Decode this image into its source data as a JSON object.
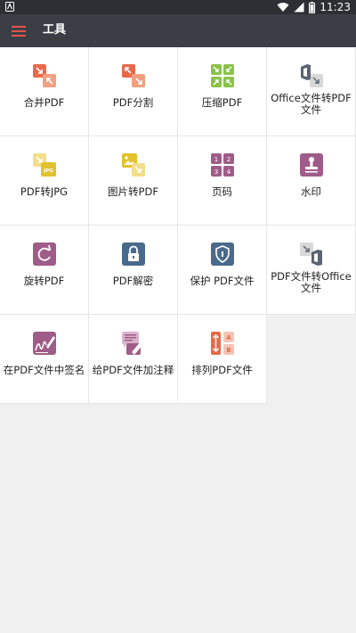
{
  "status_bar": {
    "time": "11:23",
    "icons": [
      "notification-icon",
      "wifi-icon",
      "signal-icon",
      "battery-icon"
    ]
  },
  "app_bar": {
    "title": "工具",
    "menu_icon": "hamburger-menu-icon",
    "menu_color": "#e5534b"
  },
  "tools": [
    {
      "label": "合并PDF",
      "icon": "merge-pdf-icon",
      "color": "#e8694a"
    },
    {
      "label": "PDF分割",
      "icon": "split-pdf-icon",
      "color": "#e8694a"
    },
    {
      "label": "压缩PDF",
      "icon": "compress-pdf-icon",
      "color": "#8bc34a"
    },
    {
      "label": "Office文件转PDF文件",
      "icon": "office-to-pdf-icon",
      "color": "#5a6472"
    },
    {
      "label": "PDF转JPG",
      "icon": "pdf-to-jpg-icon",
      "color": "#e2c12d"
    },
    {
      "label": "图片转PDF",
      "icon": "image-to-pdf-icon",
      "color": "#e2c12d"
    },
    {
      "label": "页码",
      "icon": "page-numbers-icon",
      "color": "#a05c88"
    },
    {
      "label": "水印",
      "icon": "watermark-stamp-icon",
      "color": "#a05c88"
    },
    {
      "label": "旋转PDF",
      "icon": "rotate-pdf-icon",
      "color": "#a05c88"
    },
    {
      "label": "PDF解密",
      "icon": "unlock-pdf-icon",
      "color": "#4a6a8c"
    },
    {
      "label": "保护 PDF文件",
      "icon": "protect-pdf-icon",
      "color": "#4a6a8c"
    },
    {
      "label": "PDF文件转Office文件",
      "icon": "pdf-to-office-icon",
      "color": "#5a6472"
    },
    {
      "label": "在PDF文件中签名",
      "icon": "sign-pdf-icon",
      "color": "#a05c88"
    },
    {
      "label": "给PDF文件加注释",
      "icon": "annotate-pdf-icon",
      "color": "#a05c88"
    },
    {
      "label": "排列PDF文件",
      "icon": "organize-pdf-icon",
      "color": "#e8694a"
    }
  ]
}
